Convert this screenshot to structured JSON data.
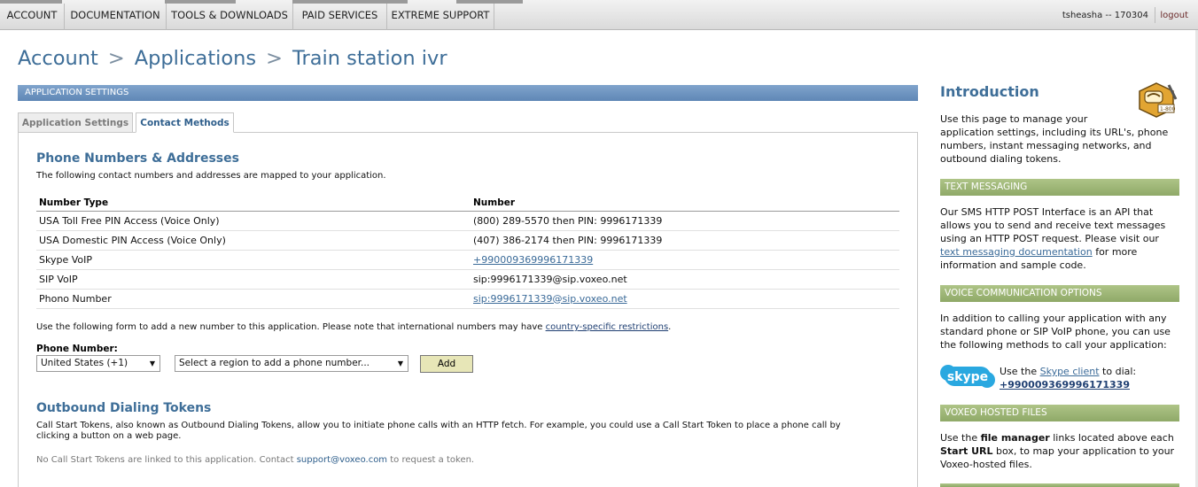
{
  "topnav": {
    "items": [
      "ACCOUNT",
      "DOCUMENTATION",
      "TOOLS & DOWNLOADS",
      "PAID SERVICES",
      "EXTREME SUPPORT"
    ],
    "user": "tsheasha -- 170304",
    "logout": "logout"
  },
  "breadcrumb": {
    "items": [
      "Account",
      "Applications",
      "Train station ivr"
    ],
    "separator": ">"
  },
  "settings_bar": "APPLICATION SETTINGS",
  "tabs": {
    "inactive": "Application Settings",
    "active": "Contact Methods"
  },
  "phone_section": {
    "title": "Phone Numbers & Addresses",
    "description": "The following contact numbers and addresses are mapped to your application.",
    "headers": [
      "Number Type",
      "Number"
    ],
    "rows": [
      {
        "type": "USA Toll Free PIN Access (Voice Only)",
        "number": "(800) 289-5570 then PIN: 9996171339"
      },
      {
        "type": "USA Domestic PIN Access (Voice Only)",
        "number": "(407) 386-2174 then PIN: 9996171339"
      },
      {
        "type": "Skype VoIP",
        "number": "+990009369996171339"
      },
      {
        "type": "SIP VoIP",
        "number": "sip:9996171339@sip.voxeo.net"
      },
      {
        "type": "Phono Number",
        "number": "sip:9996171339@sip.voxeo.net"
      }
    ],
    "form_note": "Use the following form to add a new number to this application. Please note that international numbers may have",
    "form_note_link": "country-specific restrictions",
    "form_note_end": ".",
    "phone_label": "Phone Number:",
    "country_select": "United States (+1)",
    "region_select": "Select a region to add a phone number...",
    "add_button": "Add"
  },
  "tokens_section": {
    "title": "Outbound Dialing Tokens",
    "description_line1": "Call Start Tokens, also known as Outbound Dialing Tokens, allow you to initiate phone calls with an HTTP fetch. For example, you could use a Call Start Token to place a phone call by",
    "description_line2": "clicking a button on a web page.",
    "none_text": "No Call Start Tokens are linked to this application. Contact",
    "support_email": "support@voxeo.com",
    "none_text_end": "to request a token."
  },
  "sidebar": {
    "intro_title": "Introduction",
    "intro_lines": [
      "Use this page to manage your",
      "application settings, including its URL's, phone",
      "numbers, instant messaging networks, and",
      "outbound dialing tokens."
    ],
    "text_messaging_header": "TEXT MESSAGING",
    "text_messaging_lines": [
      "Our SMS HTTP POST Interface is an API that",
      "allows you to send and receive text messages",
      "using an HTTP POST request. Please visit our"
    ],
    "text_messaging_link": "text messaging documentation",
    "text_messaging_after_link": "for more",
    "text_messaging_last": "information and sample code.",
    "voice_header": "VOICE COMMUNICATION OPTIONS",
    "voice_lines": [
      "In addition to calling your application with any",
      "standard phone or SIP VoIP phone, you can use",
      "the following methods to call your application:"
    ],
    "skype_prefix": "Use the",
    "skype_link": "Skype client",
    "skype_suffix": "to dial:",
    "skype_number": "+990009369996171339",
    "hosted_header": "VOXEO HOSTED FILES",
    "hosted_line1_pre": "Use the",
    "hosted_line1_bold": "file manager",
    "hosted_line1_post": "links located above each",
    "hosted_line2_bold": "Start URL",
    "hosted_line2_post": "box, to map your application to your",
    "hosted_line3": "Voxeo-hosted files.",
    "skype_logo_text": "skype"
  },
  "colors": {
    "link_blue": "#3e6e98",
    "settings_bar": "#6f95c1",
    "sidebar_bar": "#9fb778",
    "add_button": "#e7e6b7"
  }
}
